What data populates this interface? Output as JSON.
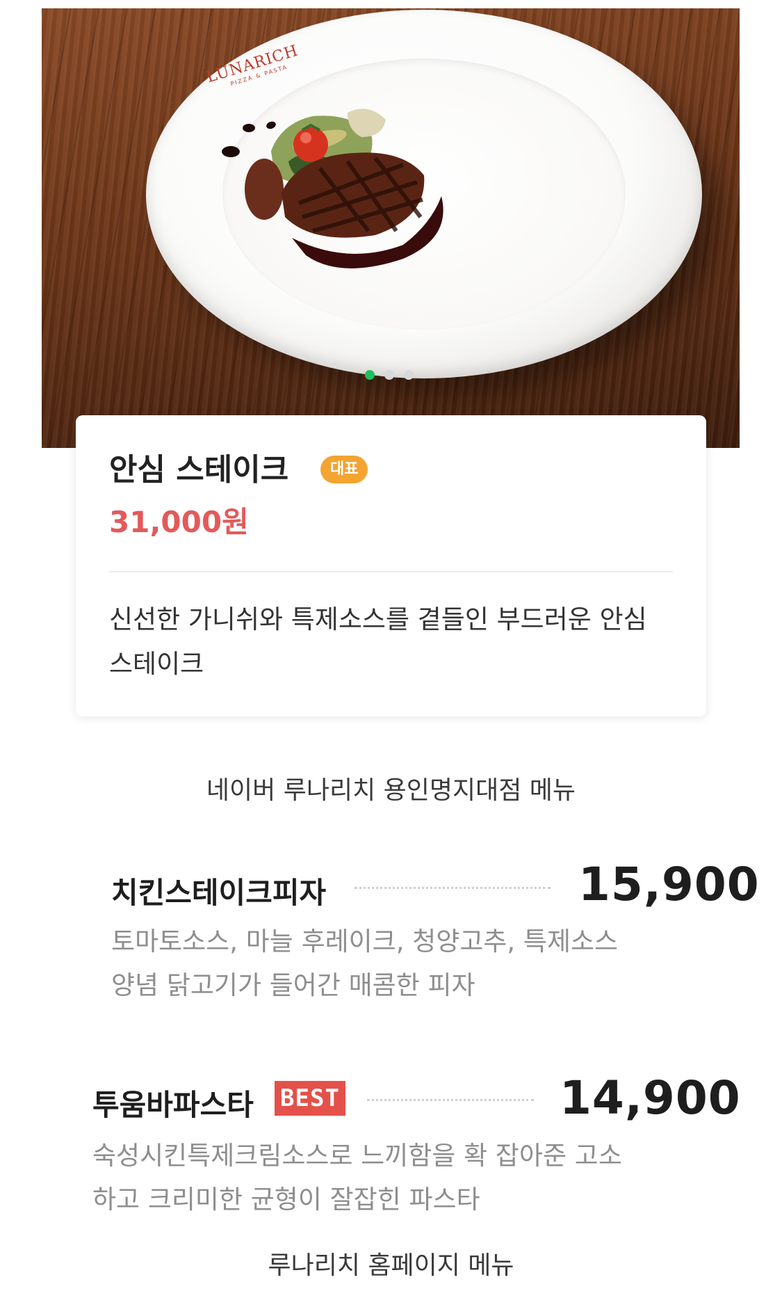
{
  "hero": {
    "logo": "LUNARICH",
    "logo_sub": "PIZZA & PASTA",
    "carousel": {
      "total": 3,
      "active": 1
    }
  },
  "featured": {
    "title": "안심 스테이크",
    "badge": "대표",
    "price": "31,000원",
    "description": "신선한 가니쉬와 특제소스를 곁들인 부드러운 안심 스테이크"
  },
  "section_caption_1": "네이버 루나리치 용인명지대점 메뉴",
  "menu": [
    {
      "name": "치킨스테이크피자",
      "price": "15,900",
      "description_lines": [
        "토마토소스, 마늘 후레이크, 청양고추, 특제소스",
        "양념 닭고기가 들어간 매콤한 피자"
      ]
    },
    {
      "name": "투움바파스타",
      "badge": "BEST",
      "price": "14,900",
      "description_lines": [
        "숙성시킨특제크림소스로 느끼함을 확 잡아준 고소",
        "하고 크리미한 균형이 잘잡힌 파스타"
      ]
    }
  ],
  "section_caption_2": "루나리치 홈페이지 메뉴",
  "colors": {
    "price_red": "#e35a5a",
    "badge_orange": "#f3a431",
    "best_red": "#e4514a",
    "dot_active": "#20c05c"
  }
}
